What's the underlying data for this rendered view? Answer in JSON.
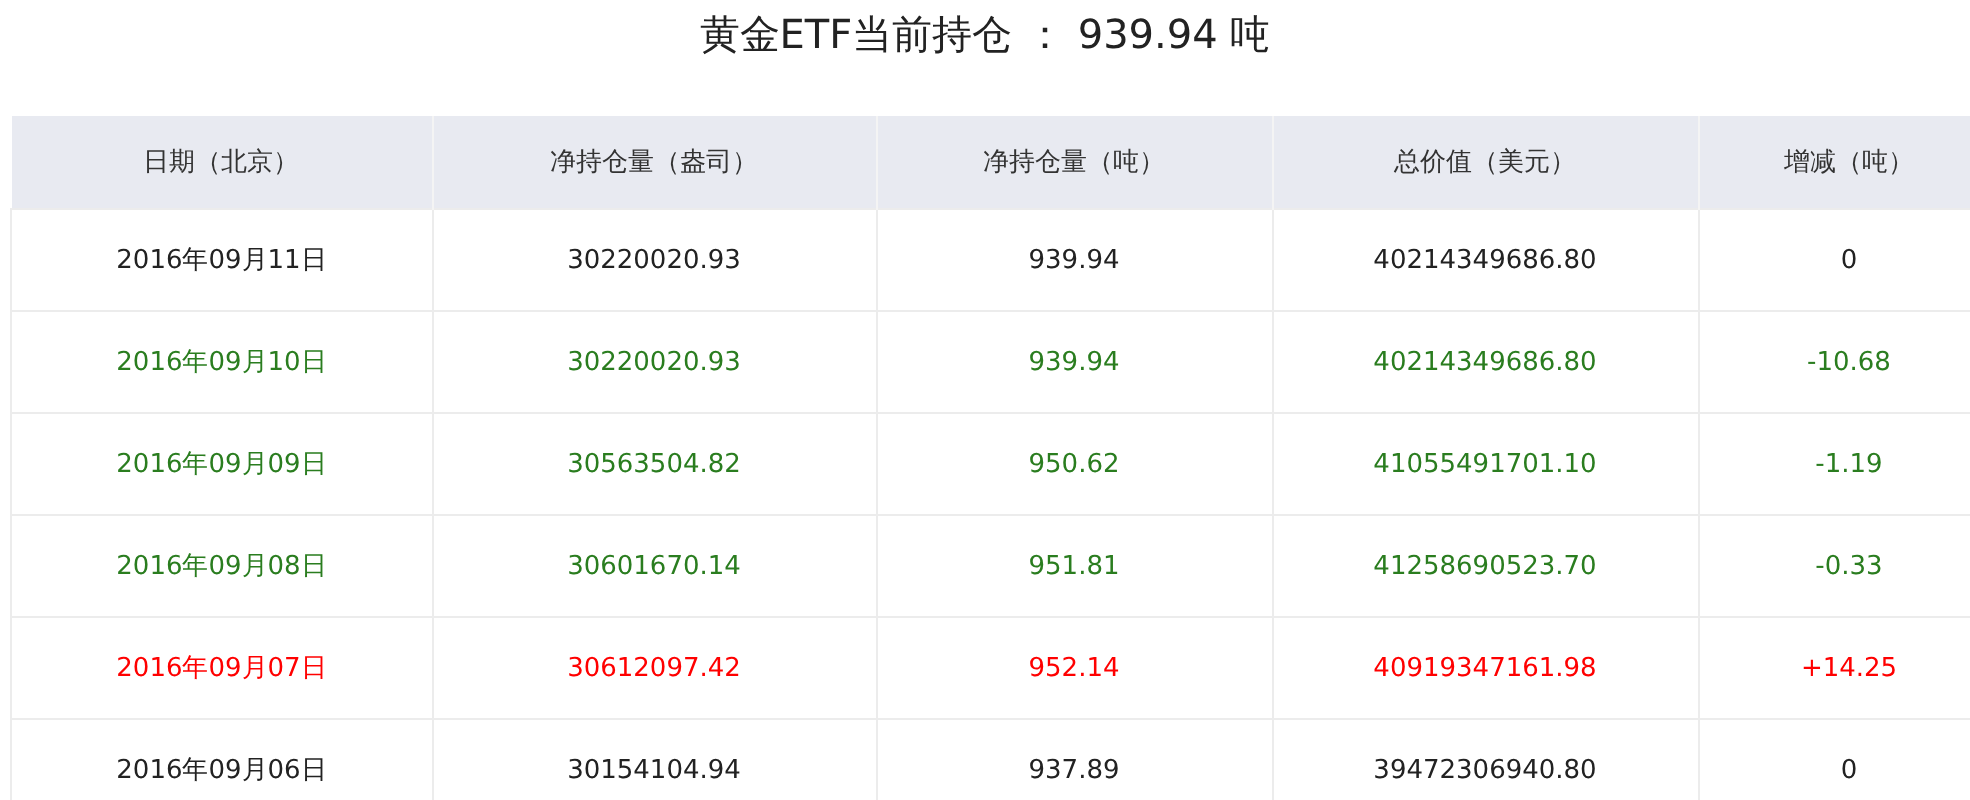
{
  "title": "黄金ETF当前持仓 ： 939.94 吨",
  "table": {
    "columns": [
      "日期（北京）",
      "净持仓量（盎司）",
      "净持仓量（吨）",
      "总价值（美元）",
      "增减（吨）"
    ],
    "rows": [
      {
        "color": "#222222",
        "cells": [
          "2016年09月11日",
          "30220020.93",
          "939.94",
          "40214349686.80",
          "0"
        ]
      },
      {
        "color": "#2a7d1f",
        "cells": [
          "2016年09月10日",
          "30220020.93",
          "939.94",
          "40214349686.80",
          "-10.68"
        ]
      },
      {
        "color": "#2a7d1f",
        "cells": [
          "2016年09月09日",
          "30563504.82",
          "950.62",
          "41055491701.10",
          "-1.19"
        ]
      },
      {
        "color": "#2a7d1f",
        "cells": [
          "2016年09月08日",
          "30601670.14",
          "951.81",
          "41258690523.70",
          "-0.33"
        ]
      },
      {
        "color": "#ff0000",
        "cells": [
          "2016年09月07日",
          "30612097.42",
          "952.14",
          "40919347161.98",
          "+14.25"
        ]
      },
      {
        "color": "#222222",
        "cells": [
          "2016年09月06日",
          "30154104.94",
          "937.89",
          "39472306940.80",
          "0"
        ]
      }
    ]
  }
}
